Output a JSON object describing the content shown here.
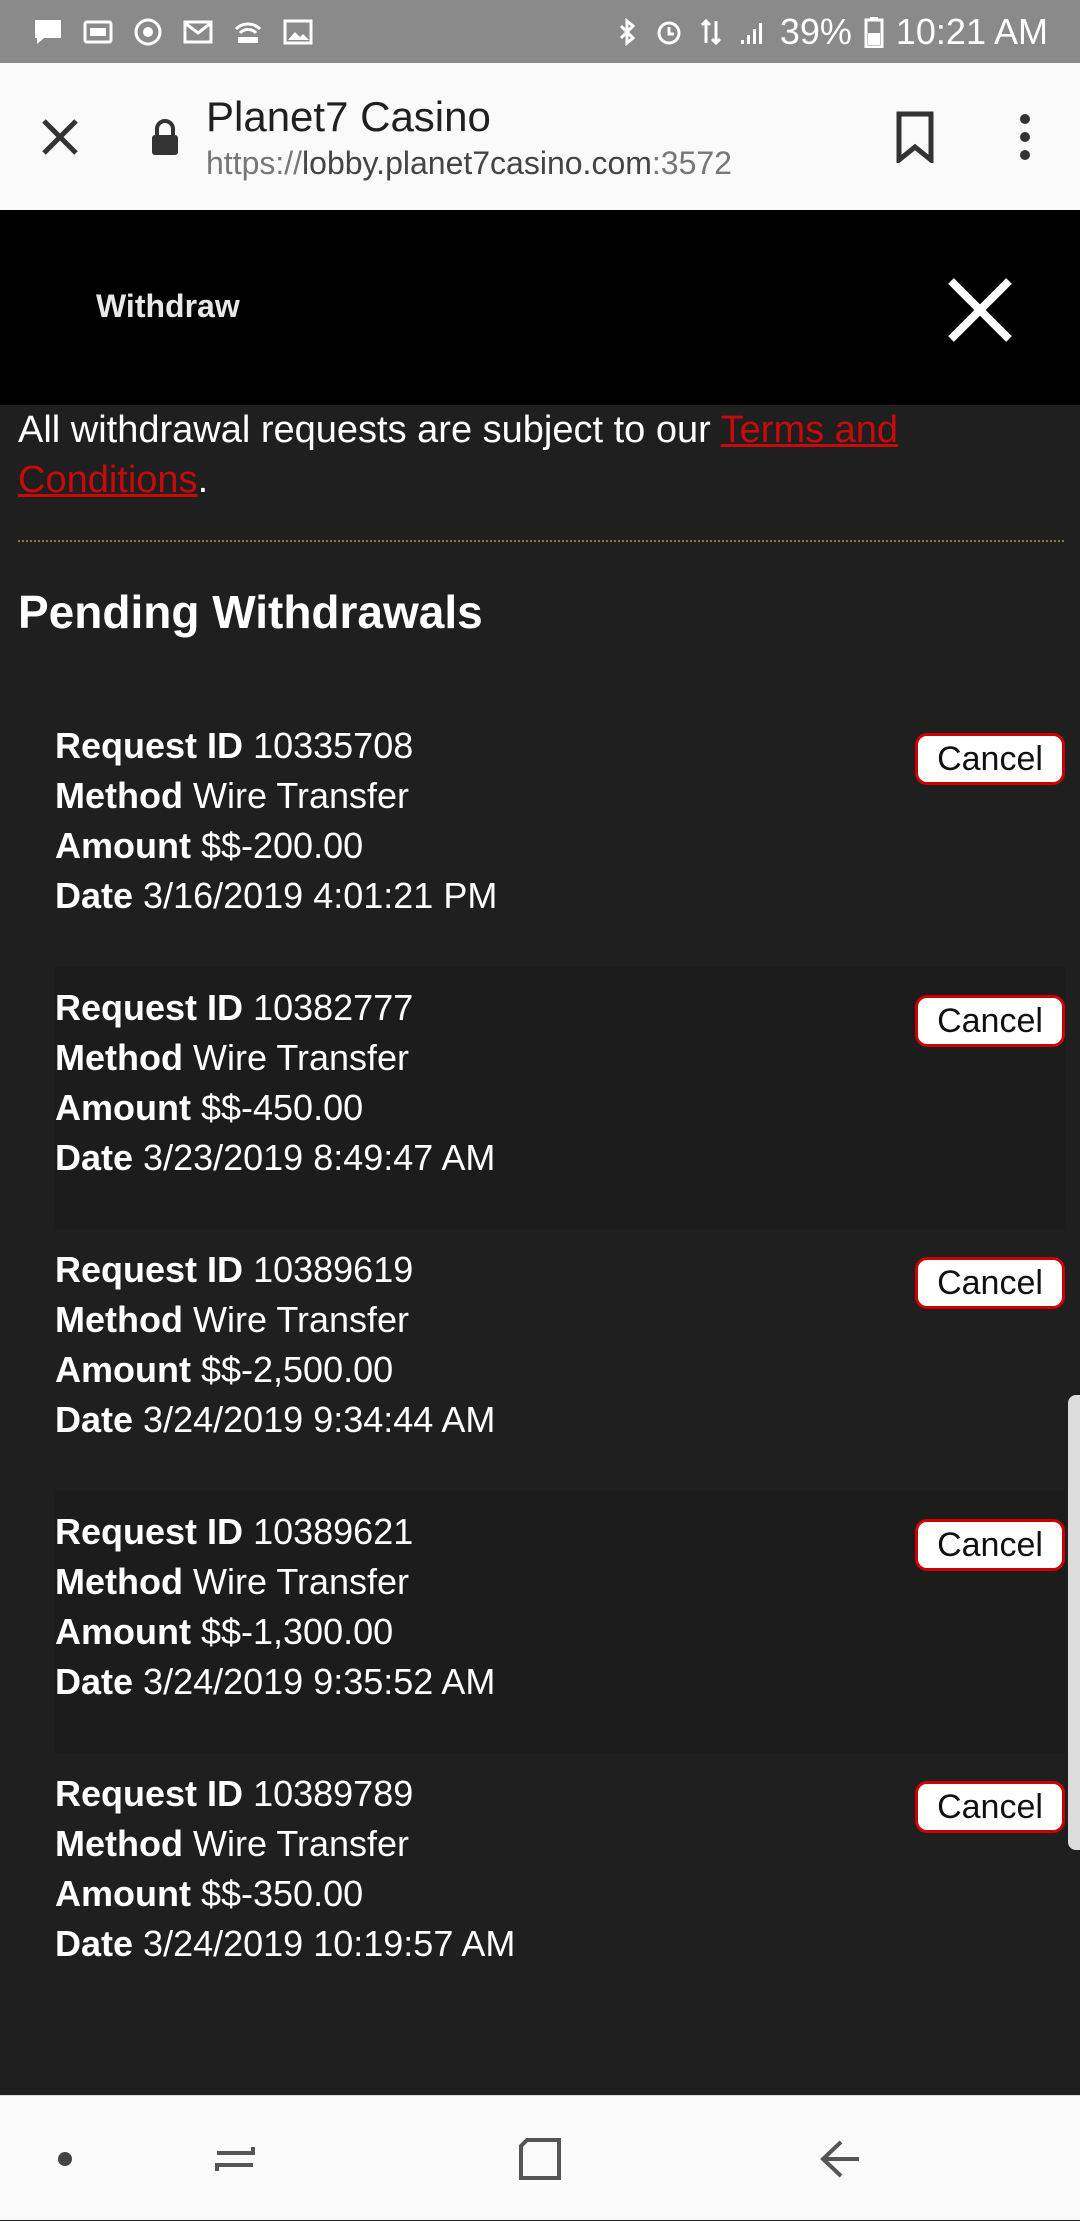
{
  "status_bar": {
    "icons_left": [
      "chat-icon",
      "pch-icon",
      "chrome-icon",
      "gmail-icon",
      "hotspot-icon",
      "gallery-icon"
    ],
    "icons_right": [
      "bluetooth-icon",
      "alarm-icon",
      "data-icon",
      "signal-icon"
    ],
    "battery": "39%",
    "time": "10:21 AM"
  },
  "browser": {
    "title": "Planet7 Casino",
    "url_scheme": "https://",
    "url_host": "lobby.planet7casino.com",
    "url_port": ":3572"
  },
  "dialog": {
    "title": "Withdraw"
  },
  "notice": {
    "text": "All withdrawal requests are subject to our ",
    "link": "Terms and Conditions",
    "end": "."
  },
  "section_title": "Pending Withdrawals",
  "labels": {
    "request_id": "Request ID",
    "method": "Method",
    "amount": "Amount",
    "date": "Date",
    "cancel": "Cancel"
  },
  "withdrawals": [
    {
      "request_id": "10335708",
      "method": "Wire Transfer",
      "amount": "$$-200.00",
      "date": "3/16/2019 4:01:21 PM"
    },
    {
      "request_id": "10382777",
      "method": "Wire Transfer",
      "amount": "$$-450.00",
      "date": "3/23/2019 8:49:47 AM"
    },
    {
      "request_id": "10389619",
      "method": "Wire Transfer",
      "amount": "$$-2,500.00",
      "date": "3/24/2019 9:34:44 AM"
    },
    {
      "request_id": "10389621",
      "method": "Wire Transfer",
      "amount": "$$-1,300.00",
      "date": "3/24/2019 9:35:52 AM"
    },
    {
      "request_id": "10389789",
      "method": "Wire Transfer",
      "amount": "$$-350.00",
      "date": "3/24/2019 10:19:57 AM"
    }
  ],
  "colors": {
    "accent_red": "#c80a0a",
    "background": "#1f1f20",
    "header_black": "#000000"
  }
}
